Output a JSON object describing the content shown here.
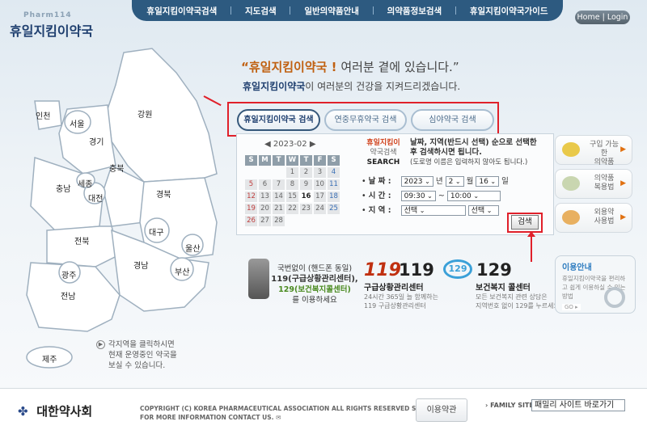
{
  "brand": {
    "sub": "Pharm114",
    "title": "휴일지킴이약국"
  },
  "nav": [
    "휴일지킴이약국검색",
    "지도검색",
    "일반의약품안내",
    "의약품정보검색",
    "휴일지킴이약국가이드"
  ],
  "home_login": "Home | Login",
  "slogan": {
    "quote_pre": "“휴일지킴이약국 !",
    "quote_post": "여러분 곁에 있습니다.”",
    "line2_bold": "휴일지킴이약국",
    "line2_rest": "이 여러분의 건강을 지켜드리겠습니다."
  },
  "tabs": [
    "휴일지킴이약국 검색",
    "연중무휴약국 검색",
    "심야약국 검색"
  ],
  "calendar": {
    "header": "◀ 2023-02 ▶",
    "weekdays": [
      "S",
      "M",
      "T",
      "W",
      "T",
      "F",
      "S"
    ],
    "weeks": [
      [
        "",
        "",
        "",
        "1",
        "2",
        "3",
        "4"
      ],
      [
        "5",
        "6",
        "7",
        "8",
        "9",
        "10",
        "11"
      ],
      [
        "12",
        "13",
        "14",
        "15",
        "16",
        "17",
        "18"
      ],
      [
        "19",
        "20",
        "21",
        "22",
        "23",
        "24",
        "25"
      ],
      [
        "26",
        "27",
        "28",
        "",
        "",
        "",
        ""
      ]
    ],
    "today": "16"
  },
  "search_box": {
    "line1": "휴일지킴이",
    "line2": "약국검색",
    "line3": "SEARCH"
  },
  "description": {
    "main1": "날짜, 지역(반드시 선택) 순으로 선택한",
    "main2": "후 검색하시면 됩니다.",
    "sub": "(도로명 이름은 입력하지 않아도 됩니다.)"
  },
  "form": {
    "date_label": "날 짜 :",
    "year": "2023",
    "year_unit": "년",
    "month": "2",
    "month_unit": "월",
    "day": "16",
    "day_unit": "일",
    "time_label": "시 간 :",
    "time_from": "09:30",
    "time_sep": "~",
    "time_to": "10:00",
    "region_label": "지 역 :",
    "region1": "선택",
    "region2": "선택",
    "search_button": "검색"
  },
  "side_buttons": [
    {
      "line1": "구입 가능한",
      "line2": "의약품",
      "icon_color": "#e9c94a"
    },
    {
      "line1": "의약품",
      "line2": "복용법",
      "icon_color": "#c9d6b0"
    },
    {
      "line1": "외용약",
      "line2": "사용법",
      "icon_color": "#e8b060"
    }
  ],
  "emergency": {
    "l1": "국번없이 (핸드폰 동일)",
    "l2": "119(구급상황관리센터),",
    "l3": "129(보건복지콜센터)",
    "l4": "를 이용하세요",
    "n119_a": "119",
    "n119_b": "119",
    "t119": "구급상황관리센터",
    "s119a": "24시간 365일 늘 함께하는",
    "s119b": "119 구급상황관리센터",
    "logo129": "129",
    "n129": "129",
    "t129": "보건복지 콜센터",
    "s129a": "모든 보건복지 관련 상담은",
    "s129b": "지역번호 없이 129를 누르세요."
  },
  "info": {
    "title": "이용안내",
    "body": "휴일지킴이약국을 편리하고 쉽게 이용하실 수 있는 방법",
    "more": "GO ▸"
  },
  "map": {
    "regions": [
      "인천",
      "서울",
      "경기",
      "강원",
      "충북",
      "세종",
      "대전",
      "충남",
      "경북",
      "대구",
      "울산",
      "전북",
      "경남",
      "부산",
      "광주",
      "전남",
      "제주"
    ],
    "note1": "각지역을 클릭하시면",
    "note2": "현재 운영중인 약국을",
    "note3": "보실 수 있습니다."
  },
  "footer": {
    "logo": "대한약사회",
    "copy1": "COPYRIGHT (C) KOREA PHARMACEUTICAL ASSOCIATION ALL RIGHTS RESERVED SINCE 2005",
    "copy2": "FOR MORE INFORMATION CONTACT US.",
    "terms": "이용약관",
    "family_label": "› FAMILY SITE",
    "family_select": "패밀리 사이트 바로가기"
  }
}
